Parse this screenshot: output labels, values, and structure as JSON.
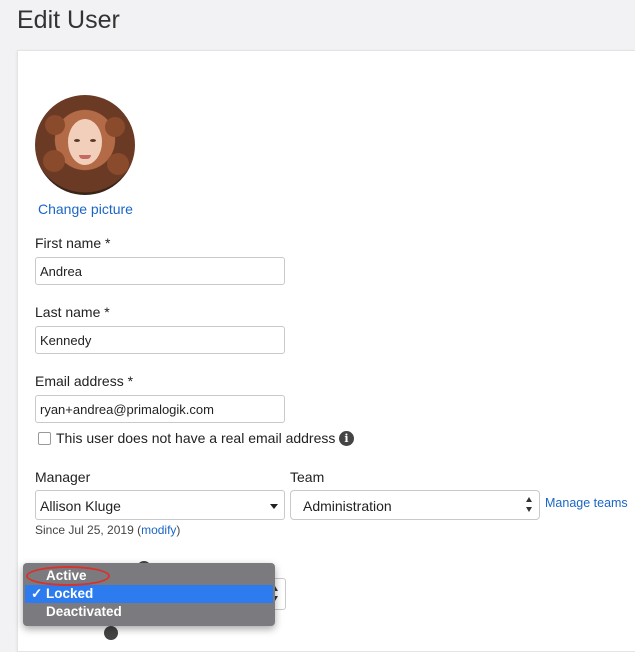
{
  "page": {
    "title": "Edit User"
  },
  "profile": {
    "change_picture": "Change picture"
  },
  "form": {
    "first_name": {
      "label": "First name *",
      "value": "Andrea"
    },
    "last_name": {
      "label": "Last name *",
      "value": "Kennedy"
    },
    "email": {
      "label": "Email address *",
      "value": "ryan+andrea@primalogik.com"
    },
    "no_email_checkbox": {
      "label": "This user does not have a real email address",
      "checked": false
    },
    "manager": {
      "label": "Manager",
      "value": "Allison Kluge"
    },
    "team": {
      "label": "Team",
      "value": "Administration"
    },
    "manage_teams": "Manage teams",
    "since": {
      "prefix": "Since Jul 25, 2019 (",
      "link": "modify",
      "suffix": ")"
    }
  },
  "status_dropdown": {
    "options": [
      "Active",
      "Locked",
      "Deactivated"
    ],
    "selected": "Locked",
    "check": "✓"
  },
  "colors": {
    "link": "#1a66c6",
    "highlight": "#2c7cf0",
    "annotation": "#d8322c"
  },
  "icons": {
    "info": "i"
  }
}
